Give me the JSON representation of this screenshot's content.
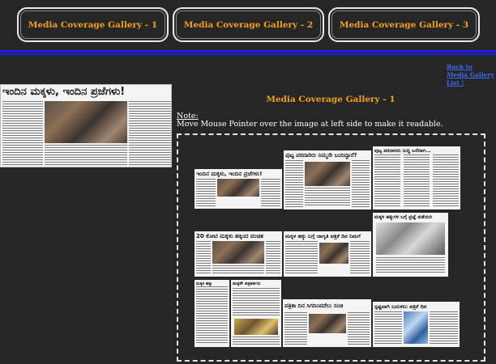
{
  "tabs": [
    {
      "label": "Media Coverage Gallery - 1"
    },
    {
      "label": "Media Coverage Gallery - 2"
    },
    {
      "label": "Media Coverage Gallery - 3"
    }
  ],
  "back_link": "Back to Media Gallery List !",
  "heading": "Media Coverage Gallery - 1",
  "note_label": "Note:",
  "note_text": "Move Mouse Pointer over the image at left side to make it readable.",
  "preview_headline": "ಇಂದಿನ ಮಕ್ಕಳು, ಇಂದಿನ ಪ್ರಜೆಗಳು!",
  "thumbs": [
    {
      "headline": "ಇಂದಿನ ಮಕ್ಕಳು, ಇಂದಿನ ಪ್ರಜೆಗಳು!"
    },
    {
      "headline": "ಪುಟ್ಟ ಪರದಾರಿರು ನಿಮ್ಮನೇ ಬಂದಿದ್ದಾರೆ?"
    },
    {
      "headline": "ಪುಟ್ಟ ಪರದಾರಿರು ಸುದ್ದಿ ಬರೆದಾಗ..."
    },
    {
      "headline": "20 ಕೋಟಿ ಮಕ್ಕಳು ಹಕ್ಕಿಂದ ವಂಚಿತ"
    },
    {
      "headline": "ಮಕ್ಕಳ ಹಕ್ಕು ಬಗ್ಗೆ ಜಾಗೃತಿ ಪತ್ರಿಕೆ ದಿನ ನಿಮಗೆ"
    },
    {
      "headline": "ಮಕ್ಕಳ ಹಕ್ಕುಗಳ ಬಗ್ಗೆ ಪ್ರಜ್ಞೆ ಪಡೆಯಿರಿ"
    },
    {
      "headline": "ಮಕ್ಕಳ ಹಕ್ಕು"
    },
    {
      "headline": "ಮಕ್ಕಳೇ ಪತ್ರಕರ್ತರು"
    },
    {
      "headline": "ಪತ್ರಿಕಾ ದಿನ ಸಿಗದಿಂಪದೆಲು ಸಂಚಿ"
    },
    {
      "headline": "ಸ್ಪಷ್ಟವಾಗಿ ಬದುಕಲು ಪತ್ರಿಕೆ ದಿನ"
    }
  ]
}
